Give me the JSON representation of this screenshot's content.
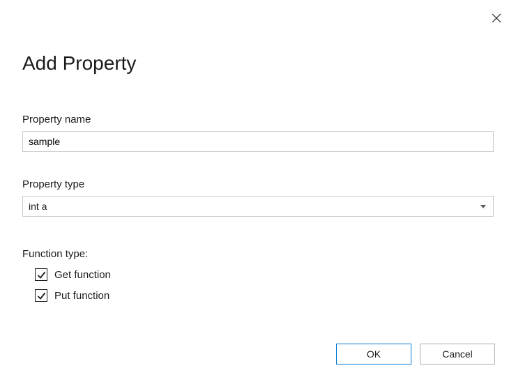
{
  "dialog": {
    "title": "Add Property"
  },
  "propertyName": {
    "label": "Property name",
    "value": "sample"
  },
  "propertyType": {
    "label": "Property type",
    "value": "int a"
  },
  "functionType": {
    "label": "Function type:",
    "getFunction": {
      "label": "Get function",
      "checked": true
    },
    "putFunction": {
      "label": "Put function",
      "checked": true
    }
  },
  "buttons": {
    "ok": "OK",
    "cancel": "Cancel"
  }
}
